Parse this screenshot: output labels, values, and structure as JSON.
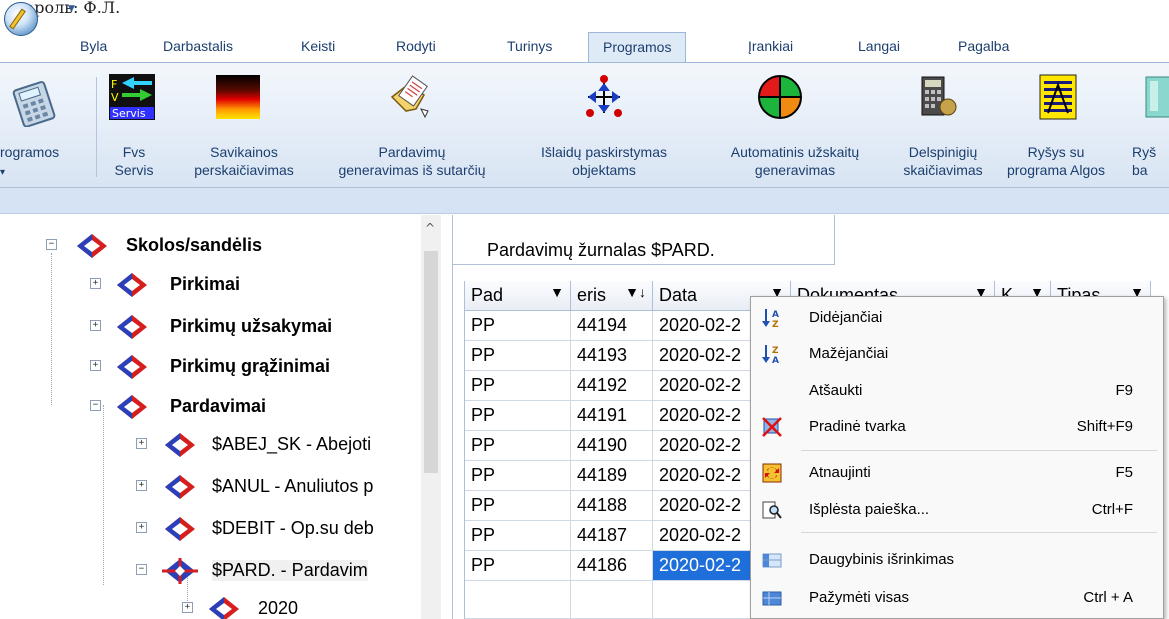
{
  "window": {
    "title_fragment": "пароль: Ф.Л."
  },
  "menu": {
    "tabs": [
      {
        "label": "Byla"
      },
      {
        "label": "Darbastalis"
      },
      {
        "label": "Keisti"
      },
      {
        "label": "Rodyti"
      },
      {
        "label": "Turinys"
      },
      {
        "label": "Programos",
        "active": true
      },
      {
        "label": "Įrankiai"
      },
      {
        "label": "Langai"
      },
      {
        "label": "Pagalba"
      }
    ]
  },
  "ribbon": {
    "buttons": [
      {
        "label_1": "rogramos",
        "label_2": "▾",
        "icon": "calculator-icon"
      },
      {
        "label_1": "Fvs",
        "label_2": "Servis",
        "icon": "fvs-servis-icon"
      },
      {
        "label_1": "Savikainos",
        "label_2": "perskaičiavimas",
        "icon": "gradient-flame-icon"
      },
      {
        "label_1": "Pardavimų",
        "label_2": "generavimas iš sutarčių",
        "icon": "folder-document-icon"
      },
      {
        "label_1": "Išlaidų paskirstymas",
        "label_2": "objektams",
        "icon": "distribution-arrows-icon"
      },
      {
        "label_1": "Automatinis užskaitų",
        "label_2": "generavimas",
        "icon": "quadrant-circle-icon"
      },
      {
        "label_1": "Delspinigių",
        "label_2": "skaičiavimas",
        "icon": "calculator-coin-icon"
      },
      {
        "label_1": "Ryšys su",
        "label_2": "programa Algos",
        "icon": "algos-building-icon"
      },
      {
        "label_1": "Ryš",
        "label_2": "ba",
        "icon": "bank-icon"
      }
    ]
  },
  "tree": {
    "nodes": [
      {
        "label": "Skolos/sandėlis",
        "expander": "−",
        "bold": true
      },
      {
        "label": "Pirkimai",
        "expander": "+",
        "bold": true
      },
      {
        "label": "Pirkimų užsakymai",
        "expander": "+",
        "bold": true
      },
      {
        "label": "Pirkimų grąžinimai",
        "expander": "+",
        "bold": true
      },
      {
        "label": "Pardavimai",
        "expander": "−",
        "bold": true
      },
      {
        "label": "$ABEJ_SK - Abejoti",
        "expander": "+",
        "bold": false
      },
      {
        "label": "$ANUL - Anuliutos p",
        "expander": "+",
        "bold": false
      },
      {
        "label": "$DEBIT - Op.su deb",
        "expander": "+",
        "bold": false
      },
      {
        "label": "$PARD. - Pardavim",
        "expander": "−",
        "bold": false,
        "selected": true
      },
      {
        "label": "2020",
        "expander": "+",
        "bold": false
      }
    ]
  },
  "grid": {
    "caption": "Pardavimų žurnalas $PARD.",
    "columns": [
      {
        "label": "Pad",
        "filter": "▼"
      },
      {
        "label": "eris",
        "filter": "▼↓"
      },
      {
        "label": "Data",
        "filter": "▼"
      },
      {
        "label": "Dokumentas",
        "filter": "▼"
      },
      {
        "label": "K",
        "filter": "▼"
      },
      {
        "label": "Tipas",
        "filter": "▼"
      }
    ],
    "rows": [
      {
        "pad": "PP",
        "nr": "44194",
        "data": "2020-02-2"
      },
      {
        "pad": "PP",
        "nr": "44193",
        "data": "2020-02-2"
      },
      {
        "pad": "PP",
        "nr": "44192",
        "data": "2020-02-2"
      },
      {
        "pad": "PP",
        "nr": "44191",
        "data": "2020-02-2"
      },
      {
        "pad": "PP",
        "nr": "44190",
        "data": "2020-02-2"
      },
      {
        "pad": "PP",
        "nr": "44189",
        "data": "2020-02-2"
      },
      {
        "pad": "PP",
        "nr": "44188",
        "data": "2020-02-2"
      },
      {
        "pad": "PP",
        "nr": "44187",
        "data": "2020-02-2"
      },
      {
        "pad": "PP",
        "nr": "44186",
        "data": "2020-02-2",
        "selected": true
      }
    ]
  },
  "context_menu": {
    "items": [
      {
        "label": "Didėjančiai",
        "shortcut": "",
        "icon": "sort-ascending-icon"
      },
      {
        "label": "Mažėjančiai",
        "shortcut": "",
        "icon": "sort-descending-icon"
      },
      {
        "label": "Atšaukti",
        "shortcut": "F9",
        "icon": ""
      },
      {
        "label": "Pradinė tvarka",
        "shortcut": "Shift+F9",
        "icon": "reset-order-icon"
      },
      {
        "label": "Atnaujinti",
        "shortcut": "F5",
        "icon": "refresh-icon"
      },
      {
        "label": "Išplėsta paieška...",
        "shortcut": "Ctrl+F",
        "icon": "advanced-search-icon"
      },
      {
        "label": "Daugybinis išrinkimas",
        "shortcut": "",
        "icon": "multi-select-icon"
      },
      {
        "label": "Pažymėti visas",
        "shortcut": "Ctrl + A",
        "icon": "select-all-icon"
      }
    ]
  }
}
